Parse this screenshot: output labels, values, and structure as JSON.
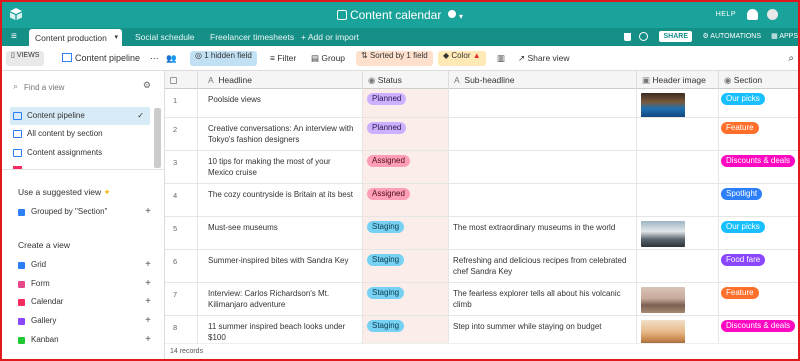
{
  "app": {
    "title": "Content calendar",
    "help": "HELP",
    "brand_color": "#1aa39a",
    "tab_bar_color": "#168f87"
  },
  "tabs": [
    {
      "label": "Content production",
      "active": true
    },
    {
      "label": "Social schedule",
      "active": false
    },
    {
      "label": "Freelancer timesheets",
      "active": false
    }
  ],
  "tab_actions": {
    "add_import": "Add or import",
    "share": "SHARE",
    "automations": "AUTOMATIONS",
    "apps": "APPS"
  },
  "toolbar": {
    "views_label": "VIEWS",
    "current_view": "Content pipeline",
    "hidden_fields": "1 hidden field",
    "filter": "Filter",
    "group": "Group",
    "sorted": "Sorted by 1 field",
    "color": "Color",
    "share_view": "Share view"
  },
  "sidebar": {
    "search_placeholder": "Find a view",
    "views": [
      {
        "label": "Content pipeline",
        "active": true
      },
      {
        "label": "All content by section",
        "active": false
      },
      {
        "label": "Content assignments",
        "active": false
      }
    ],
    "suggested_heading": "Use a suggested view",
    "suggested": [
      {
        "label": "Grouped by \"Section\""
      }
    ],
    "create_heading": "Create a view",
    "create_items": [
      {
        "label": "Grid",
        "color": "#2d7ff9"
      },
      {
        "label": "Form",
        "color": "#e8488b"
      },
      {
        "label": "Calendar",
        "color": "#f82b60"
      },
      {
        "label": "Gallery",
        "color": "#8b46ff"
      },
      {
        "label": "Kanban",
        "color": "#20c933"
      }
    ]
  },
  "columns": [
    "Headline",
    "Status",
    "Sub-headline",
    "Header image",
    "Section"
  ],
  "rows": [
    {
      "n": "1",
      "headline": "Poolside views",
      "status": "Planned",
      "sub": "",
      "image": "pool",
      "section": "Our picks"
    },
    {
      "n": "2",
      "headline": "Creative conversations: An interview with Tokyo's fashion designers",
      "status": "Planned",
      "sub": "",
      "image": "",
      "section": "Feature"
    },
    {
      "n": "3",
      "headline": "10 tips for making the most of your Mexico cruise",
      "status": "Assigned",
      "sub": "",
      "image": "",
      "section": "Discounts & deals"
    },
    {
      "n": "4",
      "headline": "The cozy countryside is Britain at its best",
      "status": "Assigned",
      "sub": "",
      "image": "",
      "section": "Spotlight"
    },
    {
      "n": "5",
      "headline": "Must-see museums",
      "status": "Staging",
      "sub": "The most extraordinary museums in the world",
      "image": "museum",
      "section": "Our picks"
    },
    {
      "n": "6",
      "headline": "Summer-inspired bites with Sandra Key",
      "status": "Staging",
      "sub": "Refreshing and delicious recipes from celebrated chef Sandra Key",
      "image": "",
      "section": "Food fare"
    },
    {
      "n": "7",
      "headline": "Interview: Carlos Richardson's Mt. Kilimanjaro adventure",
      "status": "Staging",
      "sub": "The fearless explorer tells all about his volcanic climb",
      "image": "mountain",
      "section": "Feature"
    },
    {
      "n": "8",
      "headline": "11 summer inspired beach looks under $100",
      "status": "Staging",
      "sub": "Step into summer while staying on budget",
      "image": "beach",
      "section": "Discounts & deals"
    }
  ],
  "status_colors": {
    "Planned": {
      "bg": "#cdb0ff",
      "fg": "#2b1a4e"
    },
    "Assigned": {
      "bg": "#ff9eb7",
      "fg": "#4c0c1c"
    },
    "Staging": {
      "bg": "#77d1f3",
      "fg": "#0b3a4d"
    }
  },
  "section_colors": {
    "Our picks": "#18bfff",
    "Feature": "#ff6f2c",
    "Discounts & deals": "#ff08c2",
    "Spotlight": "#2d7ff9",
    "Food fare": "#8b46ff"
  },
  "footer": {
    "records": "14 records"
  }
}
